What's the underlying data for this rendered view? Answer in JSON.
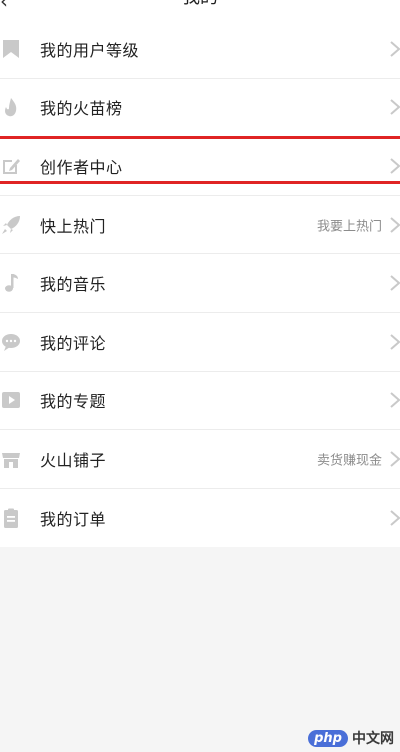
{
  "header": {
    "back_icon": "chevron-left-icon",
    "title": "我的"
  },
  "menu": [
    {
      "label": "我的用户等级",
      "hint": "",
      "icon": "bookmark-icon"
    },
    {
      "label": "我的火苗榜",
      "hint": "",
      "icon": "flame-icon"
    },
    {
      "label": "创作者中心",
      "hint": "",
      "icon": "edit-icon"
    },
    {
      "label": "快上热门",
      "hint": "我要上热门",
      "icon": "rocket-icon"
    },
    {
      "label": "我的音乐",
      "hint": "",
      "icon": "music-note-icon"
    },
    {
      "label": "我的评论",
      "hint": "",
      "icon": "comment-icon"
    },
    {
      "label": "我的专题",
      "hint": "",
      "icon": "video-collection-icon"
    },
    {
      "label": "火山铺子",
      "hint": "卖货赚现金",
      "icon": "shop-icon"
    },
    {
      "label": "我的订单",
      "hint": "",
      "icon": "clipboard-icon"
    }
  ],
  "watermark": {
    "logo": "php",
    "text": "中文网"
  },
  "colors": {
    "highlight": "#e02424",
    "icon": "#c9c9c9",
    "hint": "#8c8c8c"
  }
}
